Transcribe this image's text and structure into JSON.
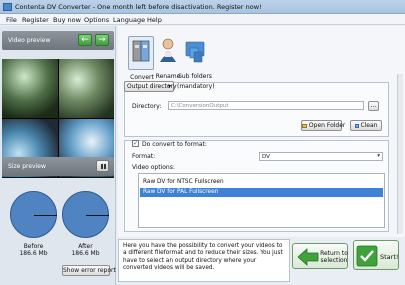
{
  "window": {
    "title": "Contenta DV Converter - One month left before disactivation. Register now!"
  },
  "menu": [
    "File",
    "Register",
    "Buy now",
    "Options",
    "Language",
    "Help"
  ],
  "left": {
    "video_preview_label": "Video preview",
    "size_preview_label": "Size preview",
    "before_label": "Before",
    "before_value": "186.6 Mb",
    "after_label": "After",
    "after_value": "186.6 Mb",
    "show_error_report": "Show error report"
  },
  "toolbar": [
    {
      "label": "Convert",
      "icon": "convert-icon"
    },
    {
      "label": "Rename",
      "icon": "rename-icon"
    },
    {
      "label": "Sub folders",
      "icon": "subfolders-icon"
    }
  ],
  "output": {
    "dropdown_value": "Output directory",
    "mandatory": "(mandatory)",
    "directory_label": "Directory:",
    "directory_placeholder": "C:\\ConversionOutput",
    "browse_label": "...",
    "open_folder": "Open Folder",
    "clean": "Clean"
  },
  "convert": {
    "checkbox_label": "Do convert to format:",
    "checked": true,
    "format_label": "Format:",
    "format_value": "DV",
    "video_options_label": "Video options:",
    "options": [
      "Raw DV for NTSC Fullscreen",
      "Raw DV for PAL Fullscreen"
    ],
    "selected_index": 1
  },
  "info": {
    "text": "Here you have the possibility to convert your videos to a different fileformat and to reduce their sizes. You just have to select an output directory where your converted videos will be saved."
  },
  "buttons": {
    "return_label": "Return to selection",
    "start_label": "Start!"
  },
  "colors": {
    "accent_green": "#3f9e3a",
    "selection_blue": "#3e82d6",
    "pie_blue": "#4f83c1"
  }
}
